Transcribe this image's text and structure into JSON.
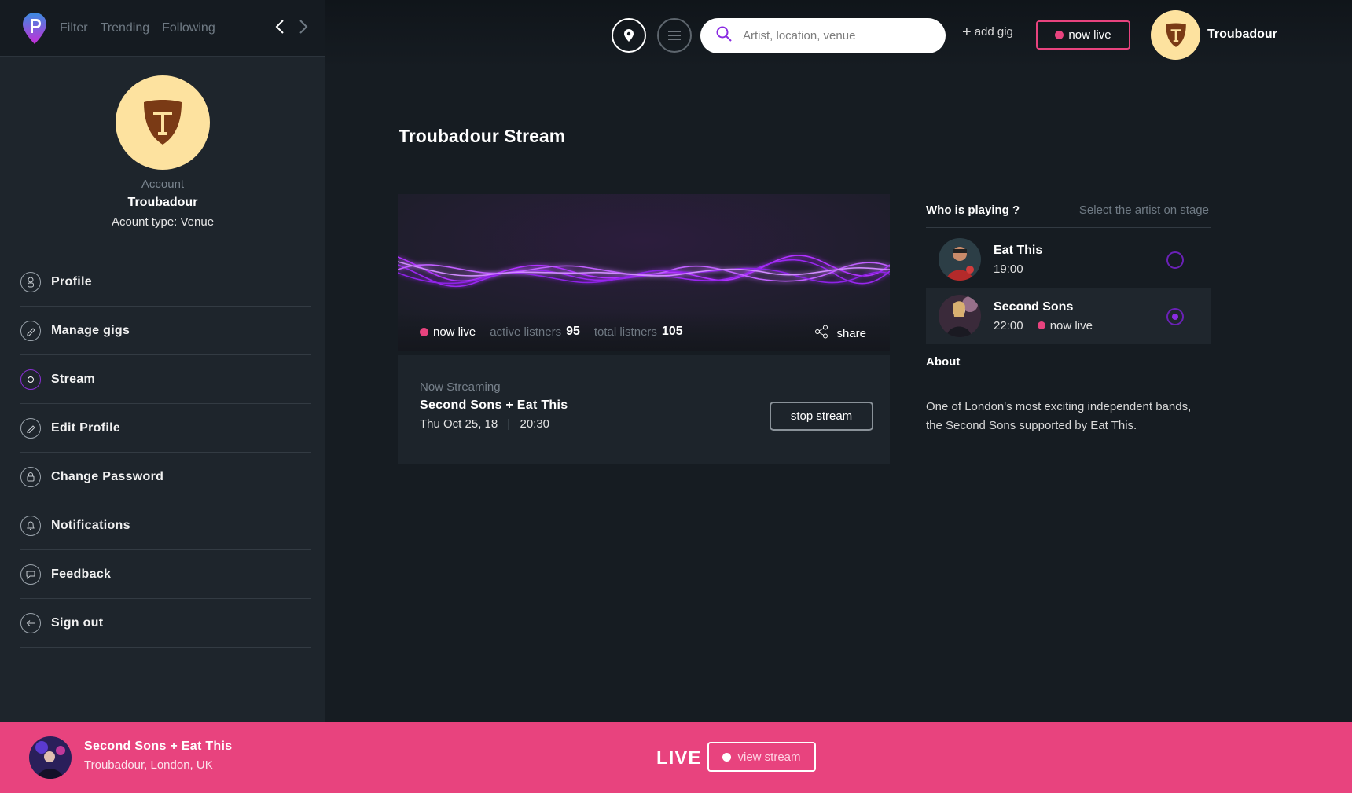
{
  "topnav": {
    "filter": "Filter",
    "trending": "Trending",
    "following": "Following"
  },
  "account": {
    "label": "Account",
    "name": "Troubadour",
    "type": "Acount type: Venue"
  },
  "menu": [
    {
      "label": "Profile",
      "icon": "user-icon"
    },
    {
      "label": "Manage gigs",
      "icon": "pencil-icon"
    },
    {
      "label": "Stream",
      "icon": "stream-icon"
    },
    {
      "label": "Edit Profile",
      "icon": "pencil-icon"
    },
    {
      "label": "Change Password",
      "icon": "lock-icon"
    },
    {
      "label": "Notifications",
      "icon": "bell-icon"
    },
    {
      "label": "Feedback",
      "icon": "chat-icon"
    },
    {
      "label": "Sign out",
      "icon": "arrow-left-icon"
    }
  ],
  "header": {
    "search_placeholder": "Artist, location, venue",
    "add_gig": "add gig",
    "now_live": "now live",
    "user_name": "Troubadour"
  },
  "page": {
    "title": "Troubadour Stream"
  },
  "stream": {
    "status": "now live",
    "active_label": "active listners",
    "active_value": "95",
    "total_label": "total listners",
    "total_value": "105",
    "share": "share"
  },
  "now_streaming": {
    "label": "Now Streaming",
    "title": "Second Sons + Eat This",
    "date": "Thu Oct 25, 18",
    "time": "20:30",
    "stop": "stop stream"
  },
  "who": {
    "title": "Who is playing ?",
    "subtitle": "Select the artist on stage",
    "artists": [
      {
        "name": "Eat This",
        "time": "19:00",
        "selected": false
      },
      {
        "name": "Second Sons",
        "time": "22:00",
        "status": "now live",
        "selected": true
      }
    ]
  },
  "about": {
    "title": "About",
    "text": "One of London's most exciting independent bands, the Second Sons supported by Eat This."
  },
  "footer": {
    "title": "Second Sons + Eat This",
    "subtitle": "Troubadour, London, UK",
    "live": "LIVE",
    "view": "view stream"
  },
  "colors": {
    "accent": "#e8437e",
    "purple": "#8a2be2",
    "crest": "#fde29f"
  }
}
